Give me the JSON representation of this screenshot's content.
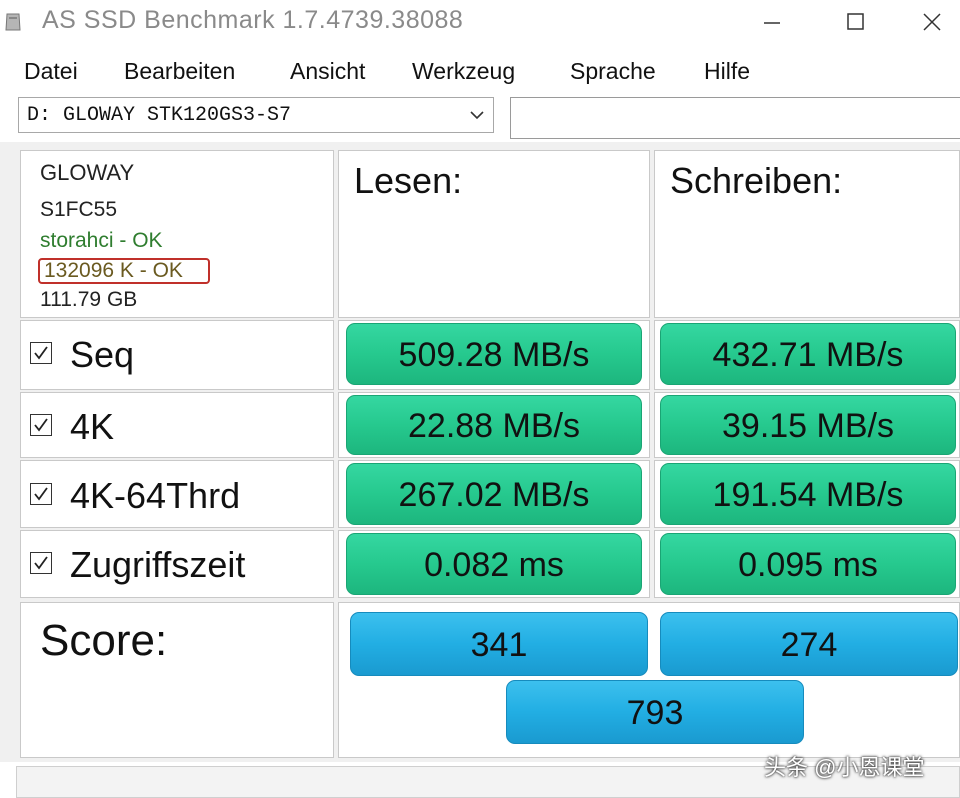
{
  "window": {
    "title": "AS SSD Benchmark 1.7.4739.38088",
    "app_icon": "ssd-drive-icon",
    "controls": [
      "minimize-icon",
      "maximize-icon",
      "close-icon"
    ]
  },
  "menu": {
    "items": [
      "Datei",
      "Bearbeiten",
      "Ansicht",
      "Werkzeug",
      "Sprache",
      "Hilfe"
    ]
  },
  "drive": {
    "selected": "D: GLOWAY STK120GS3-S7",
    "input_value": ""
  },
  "info": {
    "vendor": "GLOWAY",
    "firmware": "S1FC55",
    "driver_status": "storahci - OK",
    "alignment_status": "132096 K - OK",
    "capacity": "111.79 GB"
  },
  "columns": {
    "read": "Lesen:",
    "write": "Schreiben:"
  },
  "tests": [
    {
      "label": "Seq",
      "checked": true,
      "read": "509.28 MB/s",
      "write": "432.71 MB/s"
    },
    {
      "label": "4K",
      "checked": true,
      "read": "22.88 MB/s",
      "write": "39.15 MB/s"
    },
    {
      "label": "4K-64Thrd",
      "checked": true,
      "read": "267.02 MB/s",
      "write": "191.54 MB/s"
    },
    {
      "label": "Zugriffszeit",
      "checked": true,
      "read": "0.082 ms",
      "write": "0.095 ms"
    }
  ],
  "score": {
    "label": "Score:",
    "read": "341",
    "write": "274",
    "total": "793"
  },
  "watermark": "头条 @小恩课堂",
  "colors": {
    "result_bar": "#26c98e",
    "score_bar": "#22aee3",
    "highlight_box": "#c0302a",
    "driver_ok_text": "#2f7d2f"
  }
}
